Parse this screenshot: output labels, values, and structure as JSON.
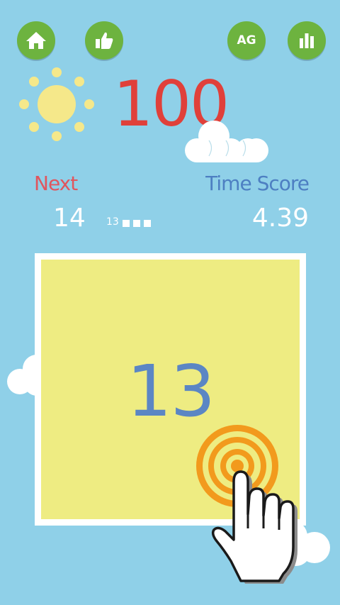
{
  "toolbar": {
    "home": {
      "icon": "home-icon"
    },
    "like": {
      "icon": "thumbs-up-icon"
    },
    "achievements": {
      "label": "AG"
    },
    "leaderboard": {
      "icon": "bar-chart-icon"
    }
  },
  "score": "100",
  "stats": {
    "next_label": "Next",
    "next_value": "14",
    "queue_current": "13",
    "queue_dots": 3,
    "time_score_label": "Time Score",
    "time_score_value": "4.39"
  },
  "board": {
    "tile_number": "13"
  },
  "colors": {
    "background": "#8fd0e8",
    "button": "#6db33f",
    "score": "#e0403a",
    "next_label": "#e0565e",
    "time_label": "#4d7fc2",
    "tile": "#eeec82",
    "tile_number": "#5b86c4",
    "sun": "#f5e88a",
    "target": "#f29a1d"
  }
}
